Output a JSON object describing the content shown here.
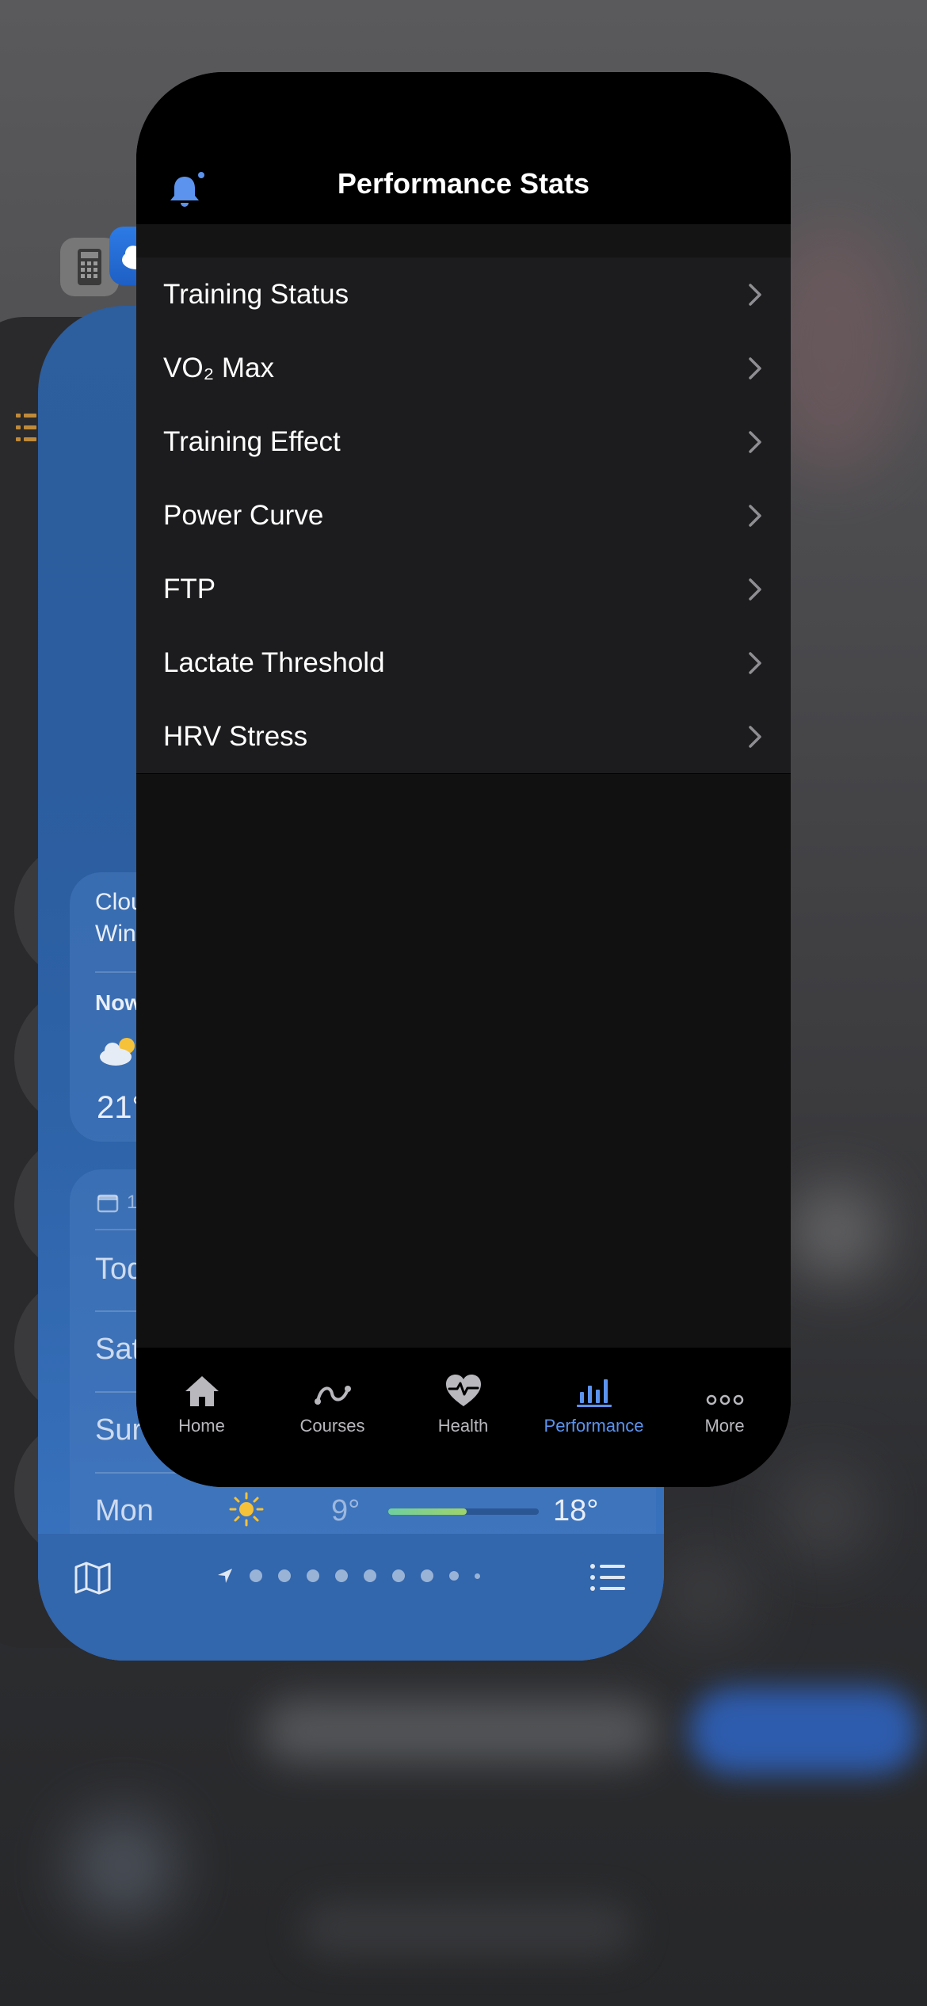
{
  "app": {
    "title": "Performance Stats",
    "menu": [
      {
        "label": "Training Status"
      },
      {
        "label": "VO₂ Max"
      },
      {
        "label": "Training Effect"
      },
      {
        "label": "Power Curve"
      },
      {
        "label": "FTP"
      },
      {
        "label": "Lactate Threshold"
      },
      {
        "label": "HRV Stress"
      }
    ],
    "tabs": [
      {
        "label": "Home",
        "icon": "house-icon"
      },
      {
        "label": "Courses",
        "icon": "route-icon"
      },
      {
        "label": "Health",
        "icon": "heart-pulse-icon"
      },
      {
        "label": "Performance",
        "icon": "bar-chart-icon",
        "active": true
      },
      {
        "label": "More",
        "icon": "ellipsis-icon"
      }
    ]
  },
  "weather_card": {
    "summary_line1": "Clou",
    "summary_line2": "Win",
    "now_label": "Now",
    "now_temp": "21°",
    "forecast_header": "1",
    "days": [
      {
        "day": "Tod"
      },
      {
        "day": "Sat"
      },
      {
        "day": "Sur"
      },
      {
        "day": "Mon",
        "low": "9°",
        "high": "18°"
      }
    ]
  },
  "colors": {
    "accent": "#5b93ee",
    "list_bg": "#1c1c1e",
    "weather_blue": "#2e63a8"
  }
}
